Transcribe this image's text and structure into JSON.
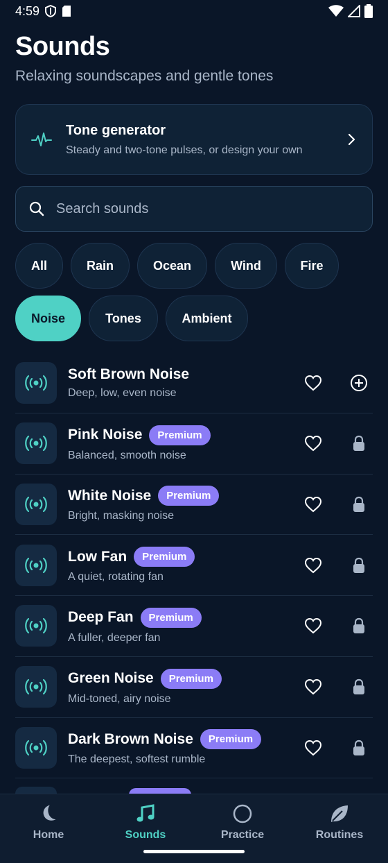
{
  "status_bar": {
    "time": "4:59"
  },
  "header": {
    "title": "Sounds",
    "subtitle": "Relaxing soundscapes and gentle tones"
  },
  "tone_card": {
    "title": "Tone generator",
    "description": "Steady and two-tone pulses, or design your own",
    "icon": "waveform-icon"
  },
  "search": {
    "placeholder": "Search sounds"
  },
  "filters": {
    "chips": [
      "All",
      "Rain",
      "Ocean",
      "Wind",
      "Fire",
      "Noise",
      "Tones",
      "Ambient"
    ],
    "selected": "Noise"
  },
  "sounds": [
    {
      "name": "Soft Brown Noise",
      "description": "Deep, low, even noise",
      "premium": false
    },
    {
      "name": "Pink Noise",
      "description": "Balanced, smooth noise",
      "premium": true
    },
    {
      "name": "White Noise",
      "description": "Bright, masking noise",
      "premium": true
    },
    {
      "name": "Low Fan",
      "description": "A quiet, rotating fan",
      "premium": true
    },
    {
      "name": "Deep Fan",
      "description": "A fuller, deeper fan",
      "premium": true
    },
    {
      "name": "Green Noise",
      "description": "Mid-toned, airy noise",
      "premium": true
    },
    {
      "name": "Dark Brown Noise",
      "description": "The deepest, softest rumble",
      "premium": true
    }
  ],
  "premium_label": "Premium",
  "bottom_nav": {
    "items": [
      {
        "label": "Home",
        "icon": "moon-icon"
      },
      {
        "label": "Sounds",
        "icon": "music-note-icon"
      },
      {
        "label": "Practice",
        "icon": "circle-icon"
      },
      {
        "label": "Routines",
        "icon": "leaf-icon"
      }
    ],
    "active": "Sounds"
  },
  "colors": {
    "background": "#0a1628",
    "accent": "#4fd1c5",
    "premium": "#8b7cf6",
    "card": "#0f2236"
  }
}
